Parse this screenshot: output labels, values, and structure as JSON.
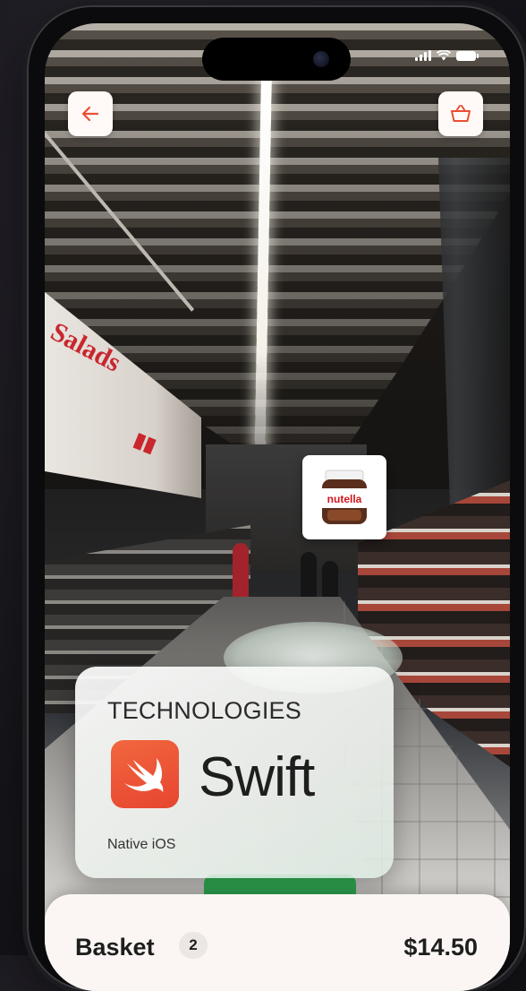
{
  "nav": {
    "back_icon": "arrow-left-icon",
    "basket_icon": "basket-icon"
  },
  "status_bar": {
    "signal_icon": "signal-bars-icon",
    "wifi_icon": "wifi-icon",
    "battery_icon": "battery-icon"
  },
  "ar_marker": {
    "product_icon": "nutella-jar-icon",
    "product_label": "nutella"
  },
  "tech_card": {
    "heading": "TECHNOLOGIES",
    "logo_icon": "swift-logo-icon",
    "name": "Swift",
    "subtitle": "Native iOS"
  },
  "basket": {
    "label": "Basket",
    "count": "2",
    "total": "$14.50"
  },
  "colors": {
    "accent": "#e94f35",
    "swift_orange": "#f05138",
    "panel_bg": "#fbf6f3",
    "success_green": "#2fa852"
  }
}
